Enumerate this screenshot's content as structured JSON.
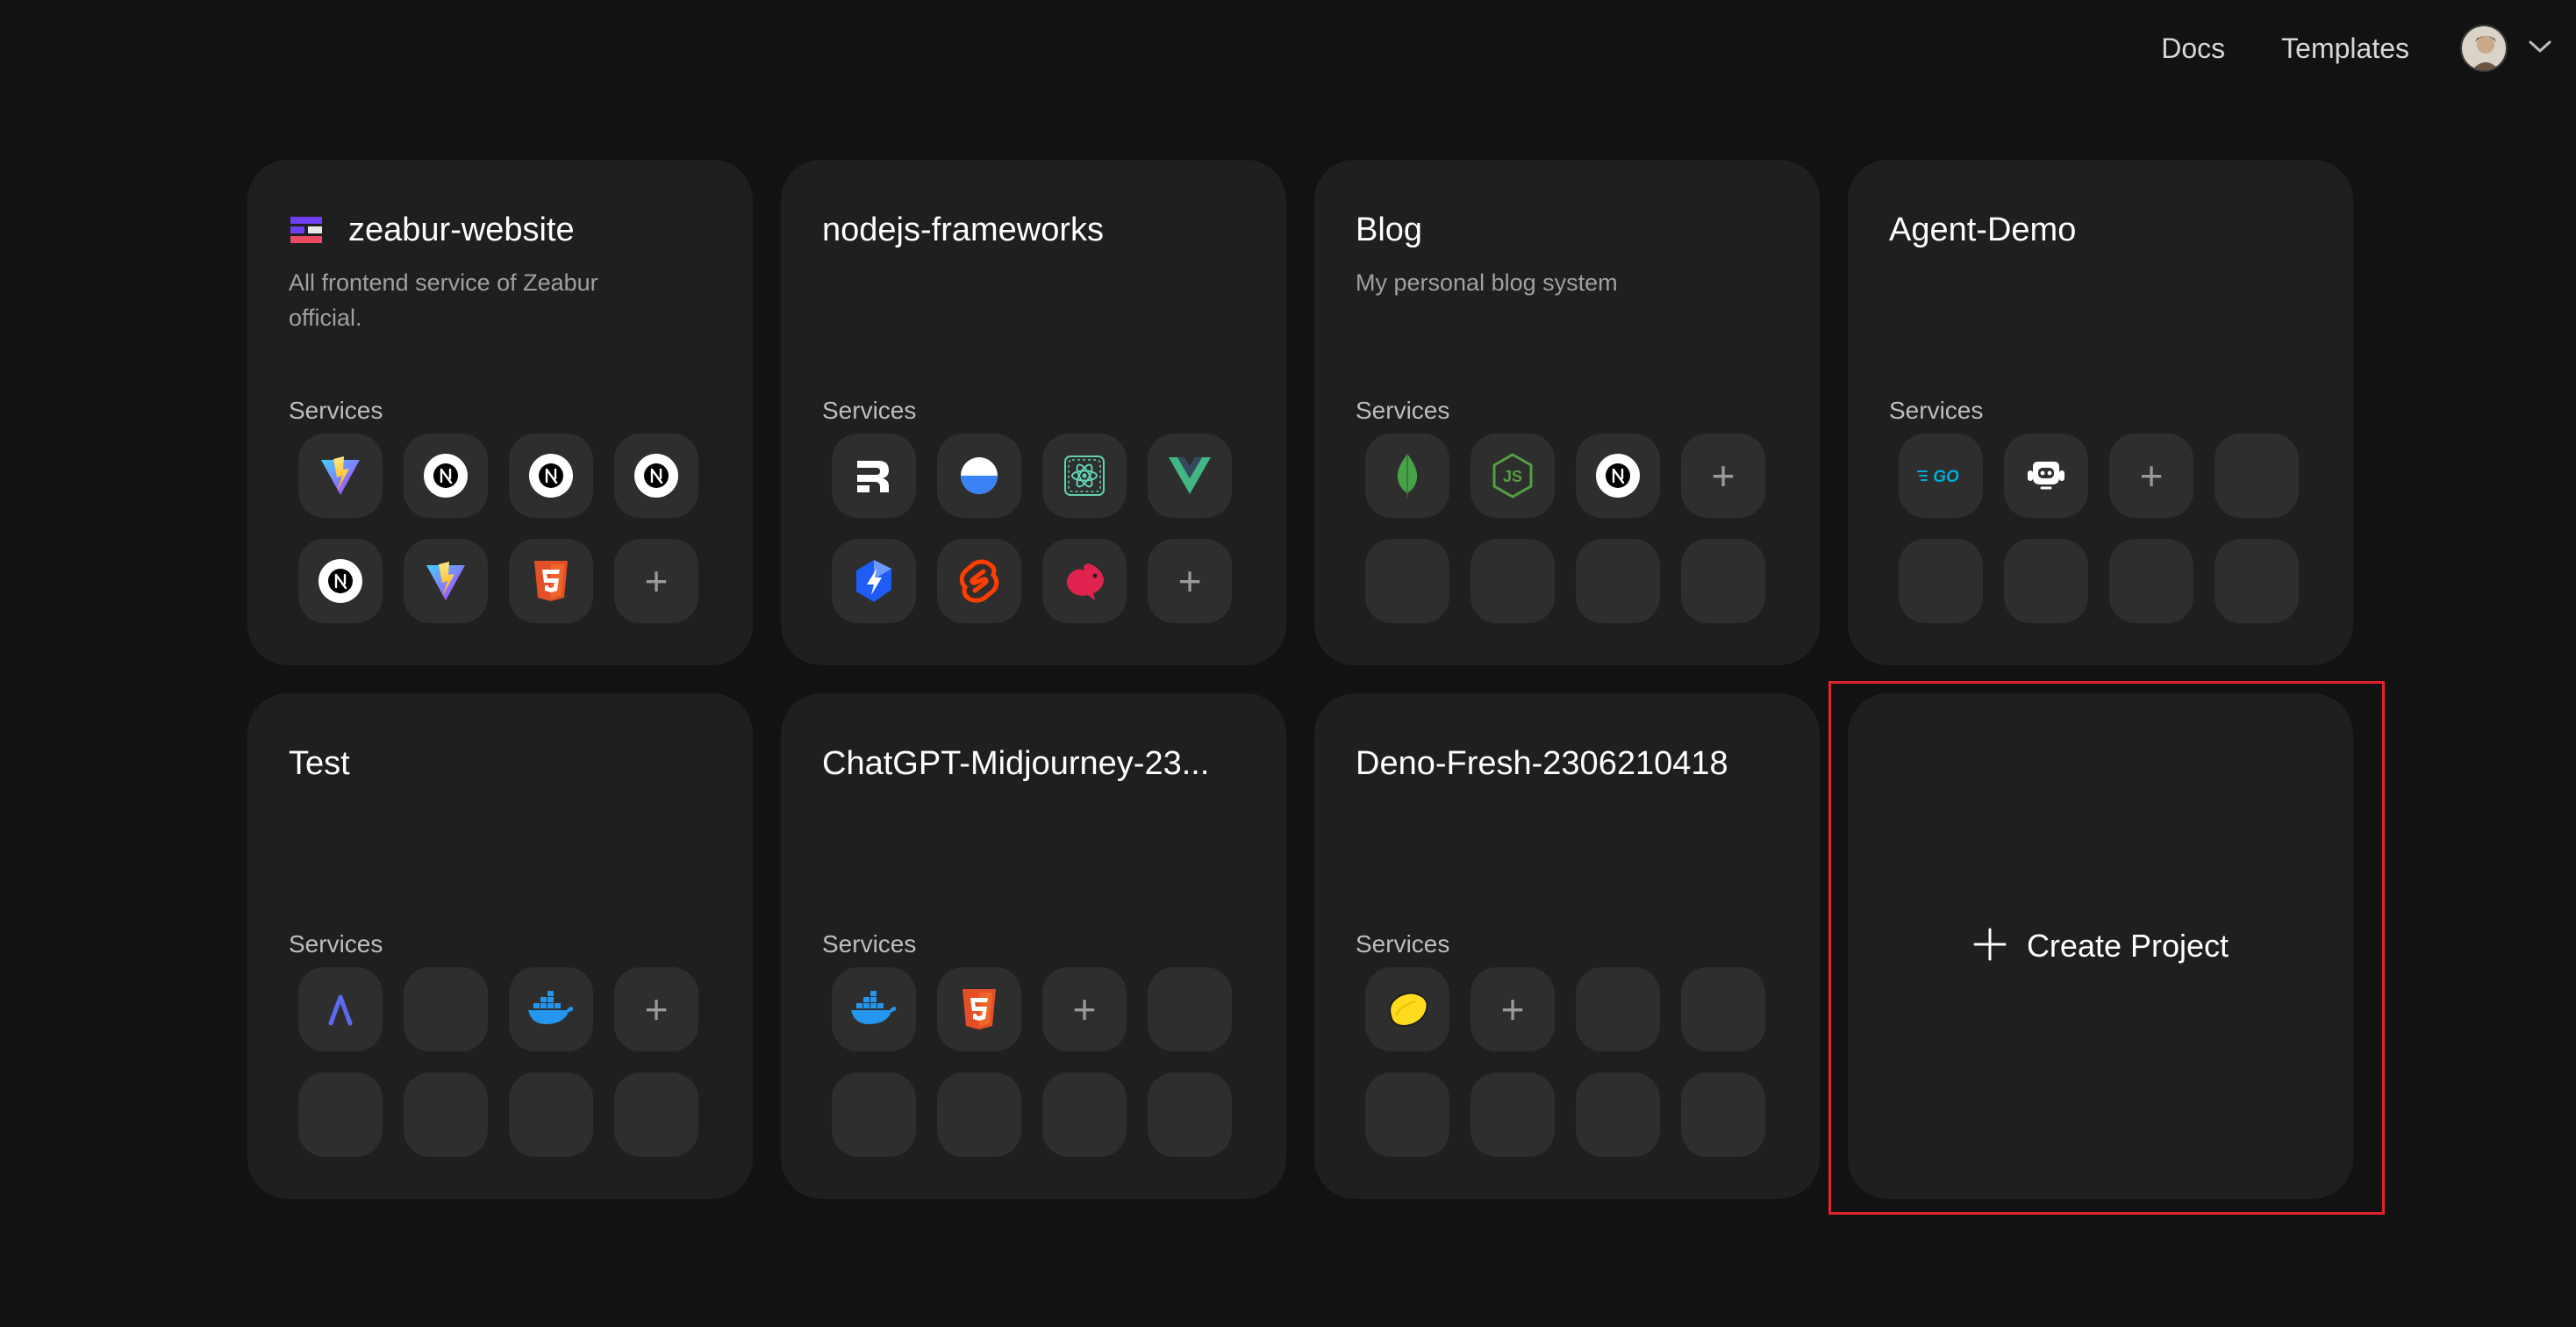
{
  "nav": {
    "docs": "Docs",
    "templates": "Templates"
  },
  "services_label": "Services",
  "projects": [
    {
      "title": "zeabur-website",
      "description": "All frontend service of Zeabur official.",
      "has_logo": true,
      "services": [
        "vite",
        "nextjs",
        "nextjs",
        "nextjs",
        "nextjs",
        "vite",
        "html5",
        "add"
      ]
    },
    {
      "title": "nodejs-frameworks",
      "description": "",
      "services": [
        "remix",
        "solid-blue",
        "react-box",
        "vue",
        "vue-lightning",
        "svelte",
        "nest",
        "add"
      ]
    },
    {
      "title": "Blog",
      "description": "My personal blog system",
      "services": [
        "mongodb",
        "nodejs",
        "nextjs",
        "add",
        "empty",
        "empty",
        "empty",
        "empty"
      ]
    },
    {
      "title": "Agent-Demo",
      "description": "",
      "services": [
        "golang",
        "bot",
        "add",
        "empty",
        "empty",
        "empty",
        "empty",
        "empty"
      ]
    },
    {
      "title": "Test",
      "description": "",
      "services": [
        "lambda",
        "empty",
        "docker",
        "add",
        "empty",
        "empty",
        "empty",
        "empty"
      ]
    },
    {
      "title": "ChatGPT-Midjourney-23...",
      "description": "",
      "services": [
        "docker",
        "html5",
        "add",
        "empty",
        "empty",
        "empty",
        "empty",
        "empty"
      ]
    },
    {
      "title": "Deno-Fresh-2306210418",
      "description": "",
      "services": [
        "fresh-lemon",
        "add",
        "empty",
        "empty",
        "empty",
        "empty",
        "empty",
        "empty"
      ]
    }
  ],
  "create_project": {
    "label": "Create Project"
  },
  "colors": {
    "background": "#121212",
    "card": "#1f1f1f",
    "tile": "#2e2e2e",
    "highlight": "#e0242a"
  }
}
